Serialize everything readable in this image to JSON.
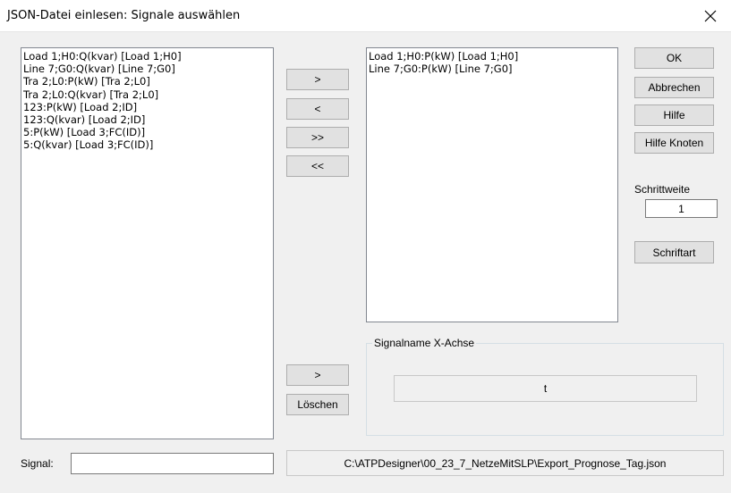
{
  "window": {
    "title": "JSON-Datei einlesen: Signale auswählen",
    "close_glyph": "✕"
  },
  "available_signals": [
    "Load 1;H0:Q(kvar) [Load 1;H0]",
    "Line 7;G0:Q(kvar) [Line 7;G0]",
    "Tra 2;L0:P(kW) [Tra 2;L0]",
    "Tra 2;L0:Q(kvar) [Tra 2;L0]",
    "123:P(kW) [Load 2;ID]",
    "123:Q(kvar) [Load 2;ID]",
    "5:P(kW) [Load 3;FC(ID)]",
    "5:Q(kvar) [Load 3;FC(ID)]"
  ],
  "selected_signals": [
    "Load 1;H0:P(kW) [Load 1;H0]",
    "Line 7;G0:P(kW) [Line 7;G0]"
  ],
  "transfer_buttons": {
    "add": ">",
    "remove": "<",
    "add_all": ">>",
    "remove_all": "<<"
  },
  "side_buttons": {
    "ok": "OK",
    "cancel": "Abbrechen",
    "help": "Hilfe",
    "help_nodes": "Hilfe Knoten",
    "font": "Schriftart"
  },
  "step": {
    "label": "Schrittweite",
    "value": "1"
  },
  "x_axis": {
    "legend": "Signalname X-Achse",
    "value": "t",
    "set_button": ">",
    "delete_button": "Löschen"
  },
  "signal": {
    "label": "Signal:",
    "value": ""
  },
  "file_path": "C:\\ATPDesigner\\00_23_7_NetzeMitSLP\\Export_Prognose_Tag.json",
  "colors": {
    "titlebar": "#ffffff",
    "dialog_bg": "#f0f0f0",
    "button_bg": "#e1e1e1",
    "button_border": "#adadad"
  },
  "icons": {
    "close": "close-icon"
  }
}
